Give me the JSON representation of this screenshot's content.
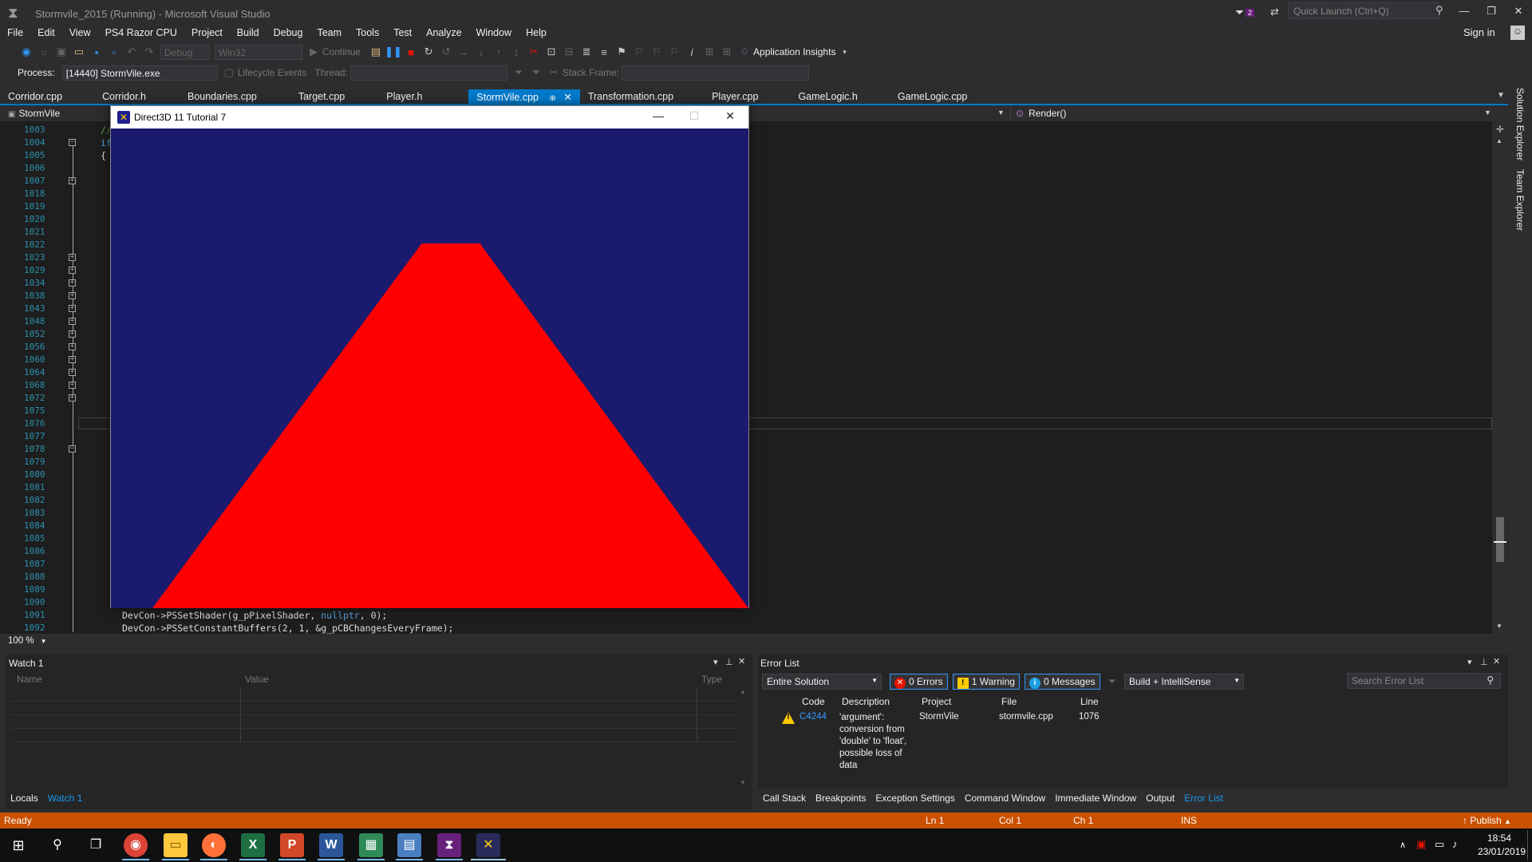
{
  "window": {
    "title": "Stormvile_2015 (Running) - Microsoft Visual Studio",
    "notification_count": "2",
    "quick_launch_placeholder": "Quick Launch (Ctrl+Q)",
    "minimize": "—",
    "maximize": "❐",
    "close": "✕"
  },
  "menu": [
    "File",
    "Edit",
    "View",
    "PS4 Razor CPU",
    "Project",
    "Build",
    "Debug",
    "Team",
    "Tools",
    "Test",
    "Analyze",
    "Window",
    "Help"
  ],
  "sign_in": "Sign in",
  "toolbar": {
    "config": "Debug",
    "platform": "Win32",
    "continue": "Continue",
    "app_insights": "Application Insights"
  },
  "process_bar": {
    "process_label": "Process:",
    "process_value": "[14440] StormVile.exe",
    "lifecycle": "Lifecycle Events",
    "thread_label": "Thread:",
    "stack_frame_label": "Stack Frame:"
  },
  "tabs": [
    "Corridor.cpp",
    "Corridor.h",
    "Boundaries.cpp",
    "Target.cpp",
    "Player.h",
    "StormVile.cpp",
    "Transformation.cpp",
    "Player.cpp",
    "GameLogic.h",
    "GameLogic.cpp"
  ],
  "active_tab": "StormVile.cpp",
  "navbar": {
    "project": "StormVile",
    "function": "Render()"
  },
  "editor": {
    "line_numbers": [
      "1003",
      "1004",
      "1005",
      "1006",
      "1007",
      "1018",
      "1019",
      "1020",
      "1021",
      "1022",
      "1023",
      "1029",
      "1034",
      "1038",
      "1043",
      "1048",
      "1052",
      "1056",
      "1060",
      "1064",
      "1068",
      "1072",
      "1075",
      "1076",
      "1077",
      "1078",
      "1079",
      "1080",
      "1081",
      "1082",
      "1083",
      "1084",
      "1085",
      "1086",
      "1087",
      "1088",
      "1089",
      "1090",
      "1091",
      "1092"
    ],
    "visible_code": {
      "l1003": "//",
      "l1004": "if",
      "l1005": "{",
      "l1091a": "DevCon->PSSetShader(g_pPixelShader, ",
      "l1091b": "nullptr",
      "l1091c": ", 0);",
      "l1092": "DevCon->PSSetConstantBuffers(2, 1, &g_pCBChangesEveryFrame);"
    },
    "zoom": "100 %"
  },
  "right_strip": {
    "solution_explorer": "Solution Explorer",
    "team_explorer": "Team Explorer"
  },
  "d3d_window": {
    "title": "Direct3D 11 Tutorial 7",
    "background_color": "#1a1a6e",
    "shape_color": "#ff0000"
  },
  "watch": {
    "title": "Watch 1",
    "headers": [
      "Name",
      "Value",
      "Type"
    ],
    "tabs": [
      "Locals",
      "Watch 1"
    ]
  },
  "error_list": {
    "title": "Error List",
    "scope": "Entire Solution",
    "errors": "0 Errors",
    "warnings": "1 Warning",
    "messages": "0 Messages",
    "source": "Build + IntelliSense",
    "search_placeholder": "Search Error List",
    "headers": [
      "Code",
      "Description",
      "Project",
      "File",
      "Line"
    ],
    "row": {
      "code": "C4244",
      "description_lines": [
        "'argument':",
        "conversion from",
        "'double' to 'float',",
        "possible loss of",
        "data"
      ],
      "project": "StormVile",
      "file": "stormvile.cpp",
      "line": "1076"
    }
  },
  "bottom_tabs_right": [
    "Call Stack",
    "Breakpoints",
    "Exception Settings",
    "Command Window",
    "Immediate Window",
    "Output",
    "Error List"
  ],
  "status": {
    "state": "Ready",
    "ln": "Ln 1",
    "col": "Col 1",
    "ch": "Ch 1",
    "mode": "INS",
    "publish": "Publish"
  },
  "taskbar": {
    "time": "18:54",
    "date": "23/01/2019"
  }
}
